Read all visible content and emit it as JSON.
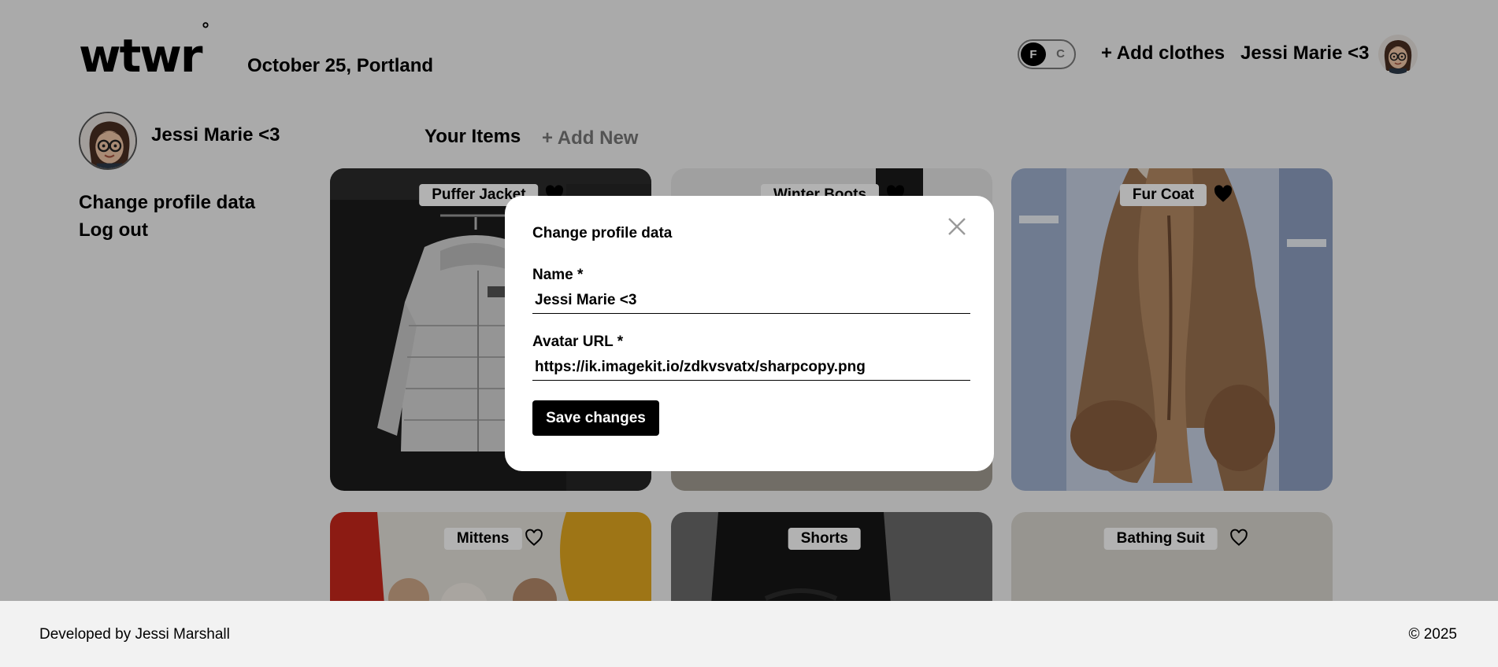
{
  "header": {
    "logo": "wtwr",
    "logo_mark": "°",
    "date_location": "October 25, Portland",
    "toggle": {
      "on_label": "F",
      "off_label": "C",
      "selected": "F"
    },
    "add_clothes": "+ Add clothes",
    "user_name": "Jessi Marie <3"
  },
  "sidebar": {
    "user_name": "Jessi Marie <3",
    "links": [
      "Change profile data",
      "Log out"
    ]
  },
  "items": {
    "title": "Your Items",
    "add_new": "+ Add New",
    "cards": [
      {
        "name": "Puffer Jacket",
        "liked": true
      },
      {
        "name": "Winter Boots",
        "liked": true
      },
      {
        "name": "Fur Coat",
        "liked": true
      },
      {
        "name": "Mittens",
        "liked": false
      },
      {
        "name": "Shorts",
        "liked": false
      },
      {
        "name": "Bathing Suit",
        "liked": false
      }
    ]
  },
  "modal": {
    "title": "Change profile data",
    "name_label": "Name *",
    "name_value": "Jessi Marie <3",
    "avatar_label": "Avatar URL *",
    "avatar_value": "https://ik.imagekit.io/zdkvsvatx/sharpcopy.png",
    "save_label": "Save changes"
  },
  "footer": {
    "developer": "Developed by Jessi Marshall",
    "copyright": "© 2025"
  }
}
